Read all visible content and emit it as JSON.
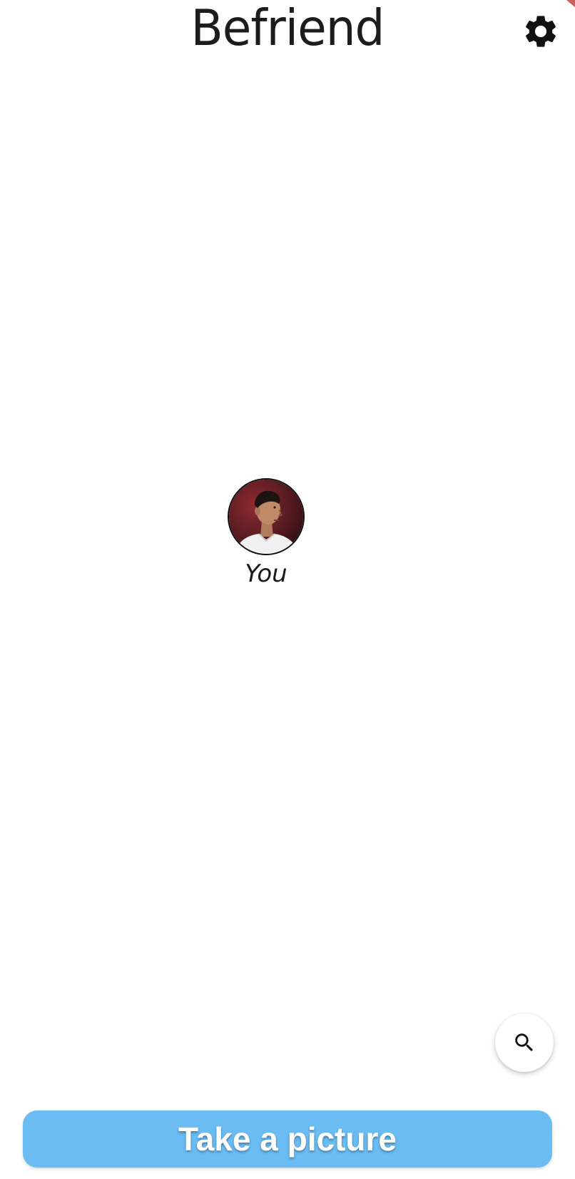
{
  "header": {
    "title": "Befriend",
    "settings_icon": "gear-icon"
  },
  "graph": {
    "self_node": {
      "label": "You",
      "avatar": "profile-photo"
    }
  },
  "search_fab": {
    "icon": "search-icon"
  },
  "footer": {
    "take_picture_label": "Take a picture"
  },
  "colors": {
    "primary_button": "#6bbcf3",
    "background": "#ffffff",
    "corner_accent": "#c9605e"
  }
}
